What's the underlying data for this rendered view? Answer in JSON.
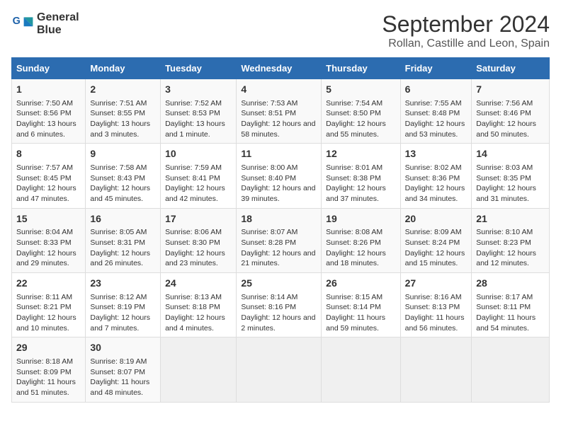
{
  "logo": {
    "line1": "General",
    "line2": "Blue"
  },
  "title": "September 2024",
  "subtitle": "Rollan, Castille and Leon, Spain",
  "days_of_week": [
    "Sunday",
    "Monday",
    "Tuesday",
    "Wednesday",
    "Thursday",
    "Friday",
    "Saturday"
  ],
  "weeks": [
    [
      {
        "day": "1",
        "sunrise": "Sunrise: 7:50 AM",
        "sunset": "Sunset: 8:56 PM",
        "daylight": "Daylight: 13 hours and 6 minutes."
      },
      {
        "day": "2",
        "sunrise": "Sunrise: 7:51 AM",
        "sunset": "Sunset: 8:55 PM",
        "daylight": "Daylight: 13 hours and 3 minutes."
      },
      {
        "day": "3",
        "sunrise": "Sunrise: 7:52 AM",
        "sunset": "Sunset: 8:53 PM",
        "daylight": "Daylight: 13 hours and 1 minute."
      },
      {
        "day": "4",
        "sunrise": "Sunrise: 7:53 AM",
        "sunset": "Sunset: 8:51 PM",
        "daylight": "Daylight: 12 hours and 58 minutes."
      },
      {
        "day": "5",
        "sunrise": "Sunrise: 7:54 AM",
        "sunset": "Sunset: 8:50 PM",
        "daylight": "Daylight: 12 hours and 55 minutes."
      },
      {
        "day": "6",
        "sunrise": "Sunrise: 7:55 AM",
        "sunset": "Sunset: 8:48 PM",
        "daylight": "Daylight: 12 hours and 53 minutes."
      },
      {
        "day": "7",
        "sunrise": "Sunrise: 7:56 AM",
        "sunset": "Sunset: 8:46 PM",
        "daylight": "Daylight: 12 hours and 50 minutes."
      }
    ],
    [
      {
        "day": "8",
        "sunrise": "Sunrise: 7:57 AM",
        "sunset": "Sunset: 8:45 PM",
        "daylight": "Daylight: 12 hours and 47 minutes."
      },
      {
        "day": "9",
        "sunrise": "Sunrise: 7:58 AM",
        "sunset": "Sunset: 8:43 PM",
        "daylight": "Daylight: 12 hours and 45 minutes."
      },
      {
        "day": "10",
        "sunrise": "Sunrise: 7:59 AM",
        "sunset": "Sunset: 8:41 PM",
        "daylight": "Daylight: 12 hours and 42 minutes."
      },
      {
        "day": "11",
        "sunrise": "Sunrise: 8:00 AM",
        "sunset": "Sunset: 8:40 PM",
        "daylight": "Daylight: 12 hours and 39 minutes."
      },
      {
        "day": "12",
        "sunrise": "Sunrise: 8:01 AM",
        "sunset": "Sunset: 8:38 PM",
        "daylight": "Daylight: 12 hours and 37 minutes."
      },
      {
        "day": "13",
        "sunrise": "Sunrise: 8:02 AM",
        "sunset": "Sunset: 8:36 PM",
        "daylight": "Daylight: 12 hours and 34 minutes."
      },
      {
        "day": "14",
        "sunrise": "Sunrise: 8:03 AM",
        "sunset": "Sunset: 8:35 PM",
        "daylight": "Daylight: 12 hours and 31 minutes."
      }
    ],
    [
      {
        "day": "15",
        "sunrise": "Sunrise: 8:04 AM",
        "sunset": "Sunset: 8:33 PM",
        "daylight": "Daylight: 12 hours and 29 minutes."
      },
      {
        "day": "16",
        "sunrise": "Sunrise: 8:05 AM",
        "sunset": "Sunset: 8:31 PM",
        "daylight": "Daylight: 12 hours and 26 minutes."
      },
      {
        "day": "17",
        "sunrise": "Sunrise: 8:06 AM",
        "sunset": "Sunset: 8:30 PM",
        "daylight": "Daylight: 12 hours and 23 minutes."
      },
      {
        "day": "18",
        "sunrise": "Sunrise: 8:07 AM",
        "sunset": "Sunset: 8:28 PM",
        "daylight": "Daylight: 12 hours and 21 minutes."
      },
      {
        "day": "19",
        "sunrise": "Sunrise: 8:08 AM",
        "sunset": "Sunset: 8:26 PM",
        "daylight": "Daylight: 12 hours and 18 minutes."
      },
      {
        "day": "20",
        "sunrise": "Sunrise: 8:09 AM",
        "sunset": "Sunset: 8:24 PM",
        "daylight": "Daylight: 12 hours and 15 minutes."
      },
      {
        "day": "21",
        "sunrise": "Sunrise: 8:10 AM",
        "sunset": "Sunset: 8:23 PM",
        "daylight": "Daylight: 12 hours and 12 minutes."
      }
    ],
    [
      {
        "day": "22",
        "sunrise": "Sunrise: 8:11 AM",
        "sunset": "Sunset: 8:21 PM",
        "daylight": "Daylight: 12 hours and 10 minutes."
      },
      {
        "day": "23",
        "sunrise": "Sunrise: 8:12 AM",
        "sunset": "Sunset: 8:19 PM",
        "daylight": "Daylight: 12 hours and 7 minutes."
      },
      {
        "day": "24",
        "sunrise": "Sunrise: 8:13 AM",
        "sunset": "Sunset: 8:18 PM",
        "daylight": "Daylight: 12 hours and 4 minutes."
      },
      {
        "day": "25",
        "sunrise": "Sunrise: 8:14 AM",
        "sunset": "Sunset: 8:16 PM",
        "daylight": "Daylight: 12 hours and 2 minutes."
      },
      {
        "day": "26",
        "sunrise": "Sunrise: 8:15 AM",
        "sunset": "Sunset: 8:14 PM",
        "daylight": "Daylight: 11 hours and 59 minutes."
      },
      {
        "day": "27",
        "sunrise": "Sunrise: 8:16 AM",
        "sunset": "Sunset: 8:13 PM",
        "daylight": "Daylight: 11 hours and 56 minutes."
      },
      {
        "day": "28",
        "sunrise": "Sunrise: 8:17 AM",
        "sunset": "Sunset: 8:11 PM",
        "daylight": "Daylight: 11 hours and 54 minutes."
      }
    ],
    [
      {
        "day": "29",
        "sunrise": "Sunrise: 8:18 AM",
        "sunset": "Sunset: 8:09 PM",
        "daylight": "Daylight: 11 hours and 51 minutes."
      },
      {
        "day": "30",
        "sunrise": "Sunrise: 8:19 AM",
        "sunset": "Sunset: 8:07 PM",
        "daylight": "Daylight: 11 hours and 48 minutes."
      },
      null,
      null,
      null,
      null,
      null
    ]
  ]
}
